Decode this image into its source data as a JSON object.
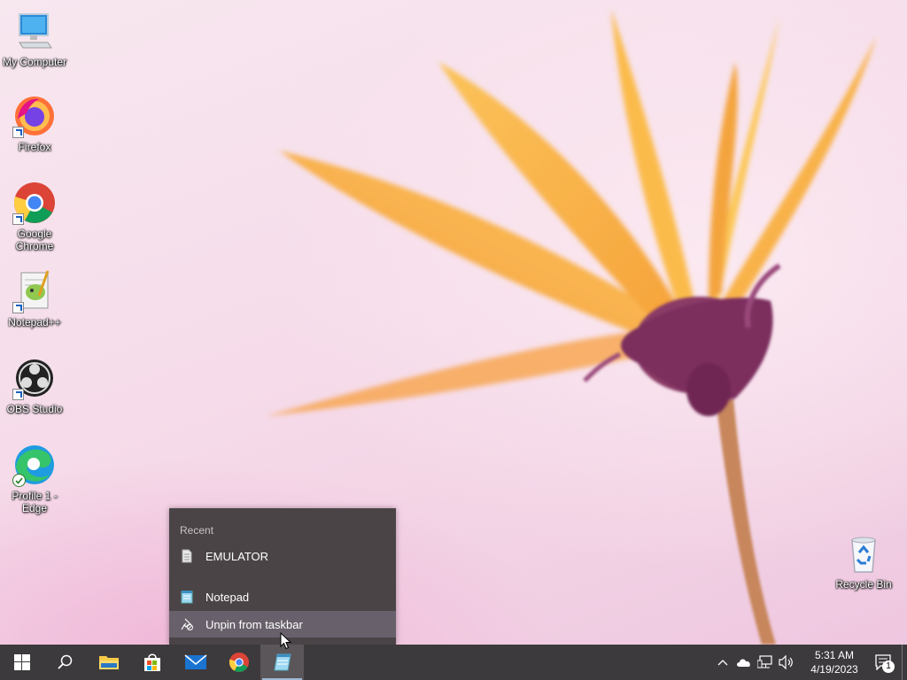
{
  "desktop": {
    "icons": [
      {
        "label": "My Computer",
        "icon": "monitor-icon"
      },
      {
        "label": "Firefox",
        "icon": "firefox-icon"
      },
      {
        "label": "Google Chrome",
        "icon": "chrome-icon"
      },
      {
        "label": "Notepad++",
        "icon": "notepadpp-icon"
      },
      {
        "label": "OBS Studio",
        "icon": "obs-icon"
      },
      {
        "label": "Profile 1 - Edge",
        "icon": "edge-icon"
      },
      {
        "label": "Recycle Bin",
        "icon": "recycle-bin-icon"
      }
    ]
  },
  "jump_list": {
    "section_title": "Recent",
    "recent_items": [
      {
        "label": "EMULATOR",
        "icon": "text-file-icon"
      }
    ],
    "app_item": {
      "label": "Notepad",
      "icon": "notepad-icon"
    },
    "unpin_item": {
      "label": "Unpin from taskbar",
      "icon": "unpin-icon"
    }
  },
  "taskbar": {
    "buttons": [
      "start-icon",
      "search-icon",
      "file-explorer-icon",
      "microsoft-store-icon",
      "mail-icon",
      "chrome-icon",
      "notepad-icon"
    ],
    "clock": {
      "time": "5:31 AM",
      "date": "4/19/2023"
    },
    "notification_count": "1"
  },
  "colors": {
    "taskbar": "#3d3a3d",
    "menu": "#4b4447",
    "menu_hover": "#68606a"
  }
}
